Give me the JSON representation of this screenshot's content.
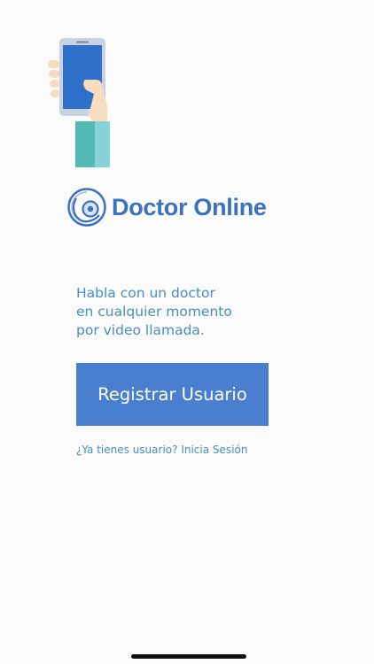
{
  "hero": {
    "icon": "hand-holding-phone-icon"
  },
  "brand": {
    "name": "Doctor Online",
    "logo_icon": "stethoscope-globe-icon",
    "color": "#3b72bf"
  },
  "tagline": [
    "Habla con un doctor",
    "en cualquier momento",
    "por video llamada."
  ],
  "register": {
    "label": "Registrar Usuario",
    "color": "#4a7fd0"
  },
  "login": {
    "prompt": "¿Ya tienes usuario?",
    "link_label": "Inicia Sesión"
  },
  "colors": {
    "text_accent": "#4a8dc1",
    "background": "#fbfbfb"
  }
}
